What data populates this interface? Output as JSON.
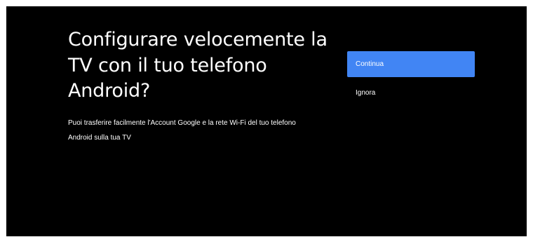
{
  "screen": {
    "title": "Configurare velocemente la TV con il tuo telefono Android?",
    "description": "Puoi trasferire facilmente l'Account Google e la rete Wi-Fi del tuo telefono Android sulla tua TV"
  },
  "actions": {
    "continue_label": "Continua",
    "skip_label": "Ignora"
  },
  "colors": {
    "background": "#000000",
    "accent": "#4185f4",
    "text": "#ffffff"
  }
}
